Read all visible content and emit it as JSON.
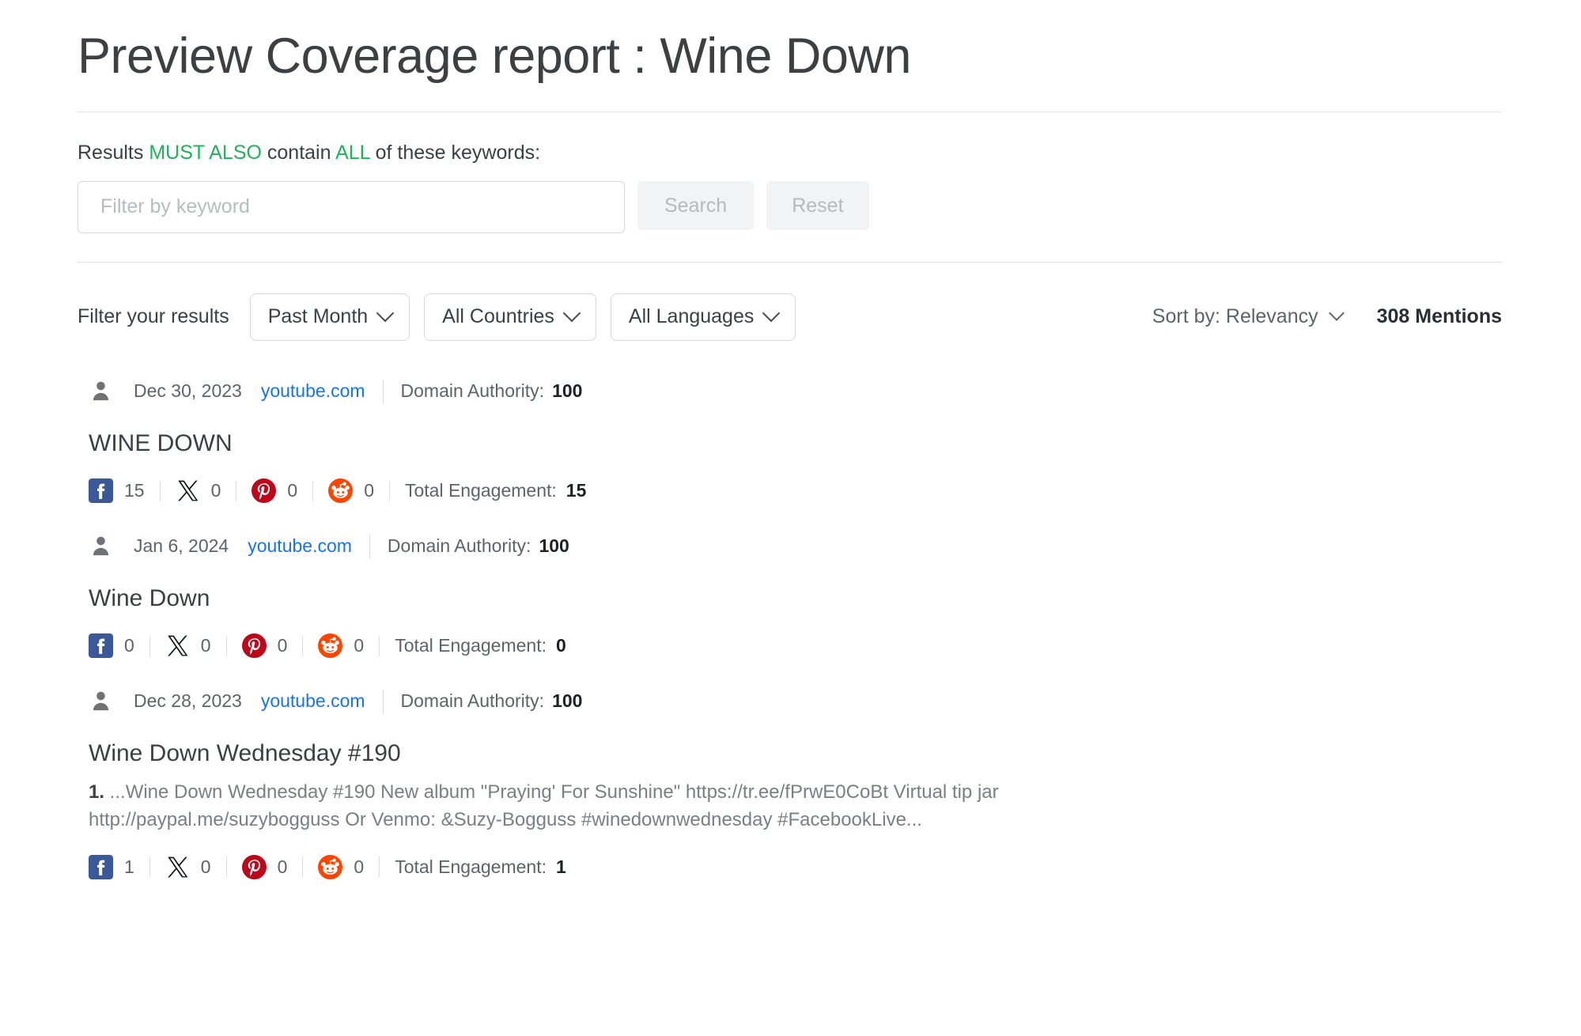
{
  "page_title": "Preview Coverage report : Wine Down",
  "keyword_filter": {
    "label_prefix": "Results ",
    "label_em1": "MUST ALSO",
    "label_mid": " contain ",
    "label_em2": "ALL",
    "label_suffix": " of these keywords:",
    "input_placeholder": "Filter by keyword",
    "input_value": "",
    "search_label": "Search",
    "reset_label": "Reset",
    "accent_green": "#1eb35a"
  },
  "filter_bar": {
    "label": "Filter your results",
    "dropdowns": [
      {
        "label": "Past Month"
      },
      {
        "label": "All Countries"
      },
      {
        "label": "All Languages"
      }
    ],
    "sort_label": "Sort by: Relevancy",
    "mentions_count": "308 Mentions"
  },
  "results": [
    {
      "date": "Dec 30, 2023",
      "domain": "youtube.com",
      "da_label": "Domain Authority:",
      "da_value": "100",
      "headline": "WINE DOWN",
      "snippet_index": "",
      "snippet": "",
      "social": [
        {
          "network": "facebook",
          "count": "15"
        },
        {
          "network": "x",
          "count": "0"
        },
        {
          "network": "pinterest",
          "count": "0"
        },
        {
          "network": "reddit",
          "count": "0"
        }
      ],
      "total_label": "Total Engagement:",
      "total_value": "15"
    },
    {
      "date": "Jan 6, 2024",
      "domain": "youtube.com",
      "da_label": "Domain Authority:",
      "da_value": "100",
      "headline": "Wine Down",
      "snippet_index": "",
      "snippet": "",
      "social": [
        {
          "network": "facebook",
          "count": "0"
        },
        {
          "network": "x",
          "count": "0"
        },
        {
          "network": "pinterest",
          "count": "0"
        },
        {
          "network": "reddit",
          "count": "0"
        }
      ],
      "total_label": "Total Engagement:",
      "total_value": "0"
    },
    {
      "date": "Dec 28, 2023",
      "domain": "youtube.com",
      "da_label": "Domain Authority:",
      "da_value": "100",
      "headline": "Wine Down Wednesday #190",
      "snippet_index": "1.",
      "snippet": " ...Wine Down Wednesday #190 New album \"Praying' For Sunshine\" https://tr.ee/fPrwE0CoBt Virtual tip jar http://paypal.me/suzybogguss Or Venmo: &Suzy-Bogguss #winedownwednesday #FacebookLive...",
      "social": [
        {
          "network": "facebook",
          "count": "1"
        },
        {
          "network": "x",
          "count": "0"
        },
        {
          "network": "pinterest",
          "count": "0"
        },
        {
          "network": "reddit",
          "count": "0"
        }
      ],
      "total_label": "Total Engagement:",
      "total_value": "1"
    }
  ],
  "icon_colors": {
    "facebook": "#3b5998",
    "x": "#0f1419",
    "pinterest": "#bd081c",
    "reddit": "#ff4500",
    "link_blue": "#1a73e8"
  }
}
